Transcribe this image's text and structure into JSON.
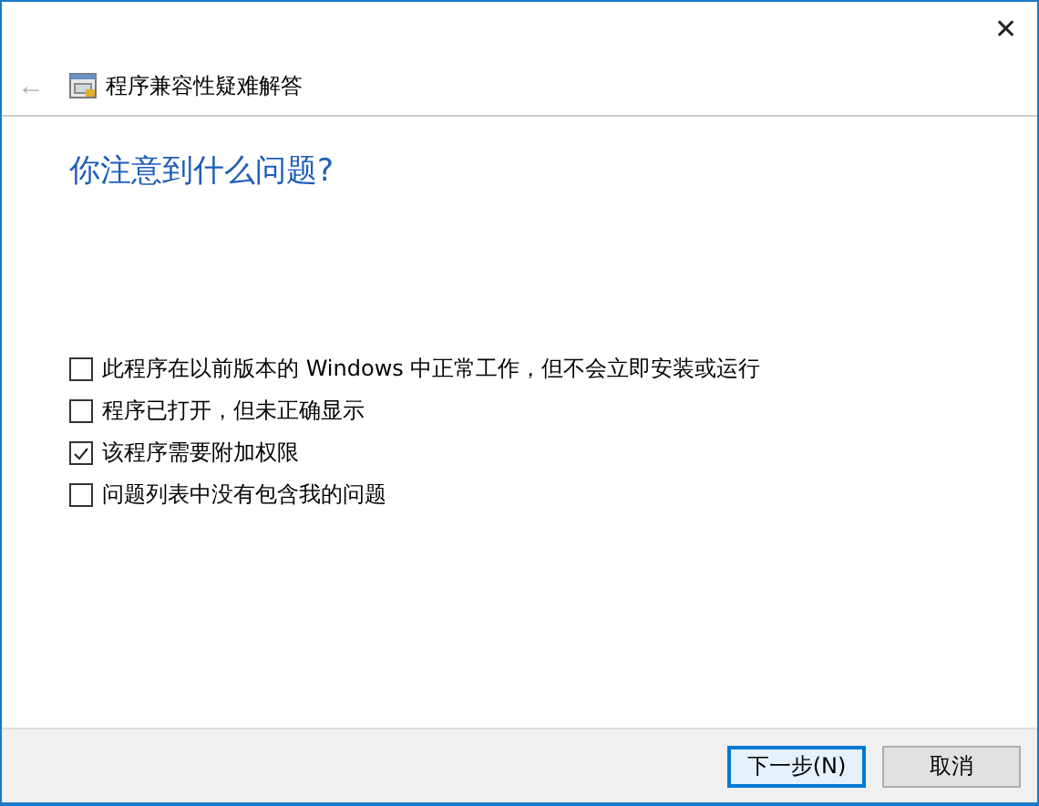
{
  "window": {
    "close": "✕"
  },
  "header": {
    "back": "←",
    "title": "程序兼容性疑难解答"
  },
  "heading": "你注意到什么问题?",
  "options": [
    {
      "label": "此程序在以前版本的 Windows 中正常工作，但不会立即安装或运行",
      "checked": false
    },
    {
      "label": "程序已打开，但未正确显示",
      "checked": false
    },
    {
      "label": "该程序需要附加权限",
      "checked": true
    },
    {
      "label": "问题列表中没有包含我的问题",
      "checked": false
    }
  ],
  "buttons": [
    {
      "label": "下一步(N)",
      "default": true
    },
    {
      "label": "取消",
      "default": false
    }
  ]
}
